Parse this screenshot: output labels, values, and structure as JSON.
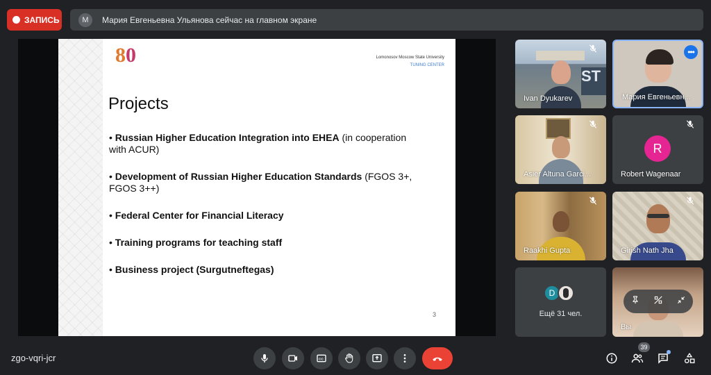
{
  "record": {
    "label": "ЗАПИСЬ"
  },
  "banner": {
    "avatar_letter": "М",
    "text": "Мария Евгеньевна Ульянова сейчас на главном экране"
  },
  "slide": {
    "logo_number": "80",
    "university": "Lomonosov Moscow State University",
    "center": "TUNING CENTER",
    "title": "Projects",
    "bullets": [
      {
        "bold": "Russian Higher Education Integration into EHEA",
        "rest": " (in cooperation with ACUR)"
      },
      {
        "bold": "Development of Russian Higher Education Standards",
        "rest": " (FGOS 3+, FGOS 3++)"
      },
      {
        "bold": "Federal Center for Financial Literacy",
        "rest": ""
      },
      {
        "bold": "Training programs for teaching staff",
        "rest": ""
      },
      {
        "bold": "Business project (Surgutneftegas)",
        "rest": ""
      }
    ],
    "page_number": "3"
  },
  "participants": [
    {
      "name": "Ivan Dyukarev",
      "muted": true
    },
    {
      "name": "Мария Евгеньевн...",
      "muted": false,
      "speaking": true
    },
    {
      "name": "Asier Altuna Garci...",
      "muted": true
    },
    {
      "name": "Robert Wagenaar",
      "avatar_letter": "R",
      "avatar_color": "#e52592",
      "muted": true
    },
    {
      "name": "Raakhi Gupta",
      "muted": true
    },
    {
      "name": "Girish Nath Jha",
      "muted": true
    }
  ],
  "others": {
    "avatar_letter": "D",
    "label": "Ещё 31 чел."
  },
  "self_tile": {
    "name": "Вы"
  },
  "bottom": {
    "meeting_code": "zgo-vqri-jcr",
    "participant_count": "39"
  },
  "colors": {
    "hangup": "#ea4335",
    "record": "#d93025",
    "accent": "#1a73e8",
    "tile_bg": "#3c4043",
    "bar_bg": "#202124"
  }
}
